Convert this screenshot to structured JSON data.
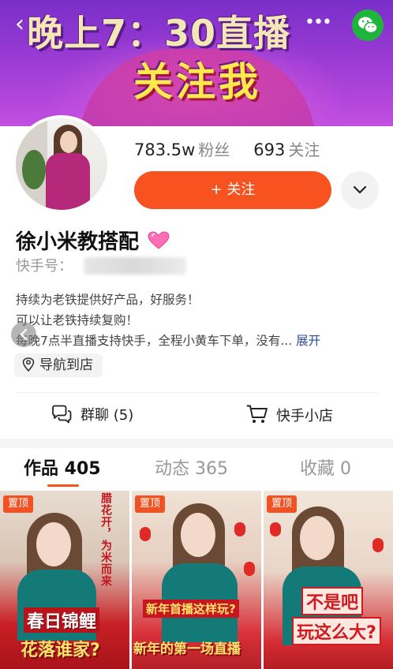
{
  "banner": {
    "line1": "晚上7：30直播",
    "line2": "关注我"
  },
  "profile": {
    "followers_count": "783.5w",
    "followers_label": "粉丝",
    "following_count": "693",
    "following_label": "关注",
    "follow_button": "+ 关注",
    "username": "徐小米教搭配",
    "ksid_label": "快手号："
  },
  "bio": {
    "line1": "持续为老铁提供好产品，好服务！",
    "line2": "可以让老铁持续复购！",
    "line3": "每晚7点半直播支持快手，全程小黄车下单，没有...",
    "expand": "展开"
  },
  "store_nav": "导航到店",
  "actions": {
    "group_chat": "群聊 (5)",
    "shop": "快手小店"
  },
  "tabs": [
    {
      "label": "作品 405",
      "active": true
    },
    {
      "label": "动态 365",
      "active": false
    },
    {
      "label": "收藏 0",
      "active": false
    }
  ],
  "grid": [
    {
      "badge": "置顶",
      "caption1": "春日锦鲤",
      "caption2": "花落谁家?",
      "side_text": "腊花开，为米而来"
    },
    {
      "badge": "置顶",
      "caption1": "新年首播这样玩?",
      "caption2": "新年的第一场直播"
    },
    {
      "badge": "置顶",
      "caption1": "不是吧",
      "caption2": "玩这么大?"
    }
  ],
  "colors": {
    "accent": "#f7521f",
    "teal": "#147a78",
    "wechat": "#1fb43c"
  }
}
